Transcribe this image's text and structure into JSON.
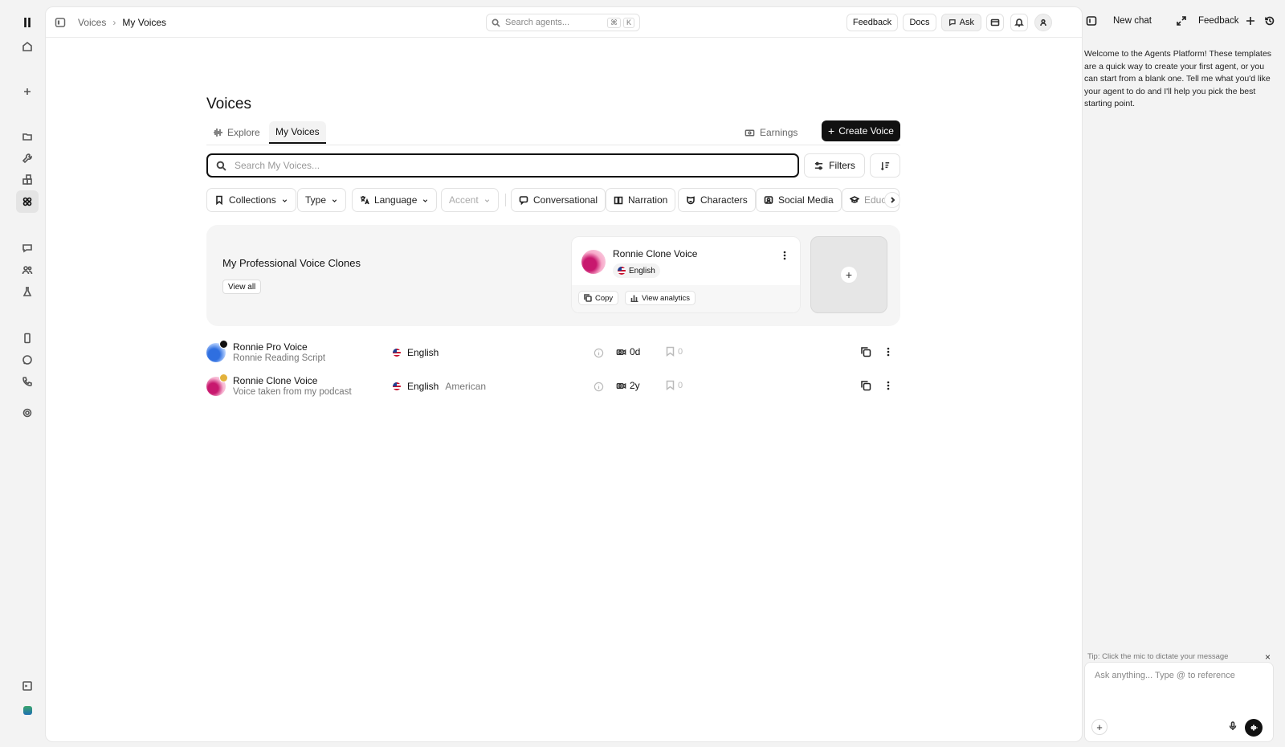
{
  "topbar": {
    "breadcrumb": [
      "Voices",
      "My Voices"
    ],
    "search_placeholder": "Search agents...",
    "shortcut": [
      "⌘",
      "K"
    ],
    "feedback_label": "Feedback",
    "docs_label": "Docs",
    "ask_label": "Ask"
  },
  "page": {
    "title": "Voices",
    "tabs": [
      {
        "label": "Explore",
        "icon": "waveform-icon",
        "active": false
      },
      {
        "label": "My Voices",
        "icon": "",
        "active": true
      }
    ],
    "earnings_label": "Earnings",
    "create_label": "Create Voice",
    "search_placeholder": "Search My Voices...",
    "filters_label": "Filters",
    "chips": [
      {
        "label": "Collections",
        "icon": "bookmark-icon",
        "dropdown": true
      },
      {
        "label": "Type",
        "dropdown": true
      },
      {
        "label": "Language",
        "icon": "translate-icon",
        "dropdown": true
      },
      {
        "label": "Accent",
        "dropdown": true,
        "disabled": true
      },
      {
        "label": "Conversational",
        "icon": "chat-bubble-icon"
      },
      {
        "label": "Narration",
        "icon": "book-icon"
      },
      {
        "label": "Characters",
        "icon": "mask-icon"
      },
      {
        "label": "Social Media",
        "icon": "social-icon"
      },
      {
        "label": "Educ",
        "icon": "graduation-cap-icon"
      }
    ]
  },
  "pvc": {
    "title": "My Professional Voice Clones",
    "view_all": "View all",
    "card": {
      "name": "Ronnie Clone Voice",
      "language": "English",
      "copy_label": "Copy",
      "analytics_label": "View analytics"
    },
    "add_symbol": "+"
  },
  "voices": [
    {
      "name": "Ronnie Pro Voice",
      "description": "Ronnie Reading Script",
      "language": "English",
      "accent": "",
      "age": "0d",
      "saves": "0",
      "badge_color": "#111111",
      "avatar_colors": [
        "#2f6fe0",
        "#b9d3ff"
      ]
    },
    {
      "name": "Ronnie Clone Voice",
      "description": "Voice taken from my podcast",
      "language": "English",
      "accent": "American",
      "age": "2y",
      "saves": "0",
      "badge_color": "#e3b23c",
      "avatar_colors": [
        "#c8186e",
        "#f7b6d2"
      ]
    }
  ],
  "chat": {
    "new_chat_label": "New chat",
    "feedback_label": "Feedback",
    "welcome": "Welcome to the Agents Platform! These templates are a quick way to create your first agent, or you can start from a blank one. Tell me what you'd like your agent to do and I'll help you pick the best starting point.",
    "tip": "Tip: Click the mic to dictate your message",
    "tip_close": "×",
    "input_placeholder": "Ask anything... Type @ to reference",
    "plus_symbol": "+"
  },
  "colors": {
    "accent": "#111111",
    "panel_bg": "#f5f5f5",
    "page_bg": "#f3f3f3"
  }
}
